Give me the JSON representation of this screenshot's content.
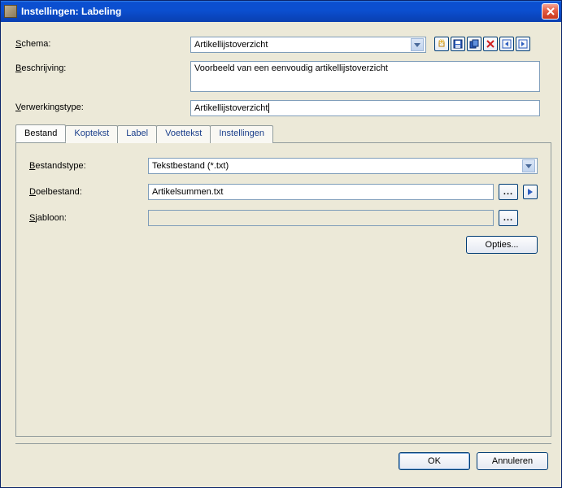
{
  "window": {
    "title": "Instellingen: Labeling"
  },
  "form": {
    "schema_label_pre": "S",
    "schema_label_post": "chema:",
    "beschrijving_label_pre": "B",
    "beschrijving_label_post": "eschrijving:",
    "verwerkingstype_label_pre": "V",
    "verwerkingstype_label_post": "erwerkingstype:",
    "schema_value": "Artikellijstoverzicht",
    "beschrijving_value": "Voorbeeld van een eenvoudig artikellijstoverzicht",
    "verwerkingstype_value": "Artikellijstoverzicht"
  },
  "toolbar_icons": [
    "new-icon",
    "save-icon",
    "copy-icon",
    "delete-icon",
    "prev-icon",
    "next-icon"
  ],
  "tabs": [
    {
      "label": "Bestand",
      "active": true
    },
    {
      "label": "Koptekst",
      "active": false
    },
    {
      "label": "Label",
      "active": false
    },
    {
      "label": "Voettekst",
      "active": false
    },
    {
      "label": "Instellingen",
      "active": false
    }
  ],
  "panel": {
    "bestandstype_label_pre": "B",
    "bestandstype_label_post": "estandstype:",
    "doelbestand_label_pre": "D",
    "doelbestand_label_post": "oelbestand:",
    "sjabloon_label_pre": "S",
    "sjabloon_label_post": "jabloon:",
    "bestandstype_value": "Tekstbestand (*.txt)",
    "doelbestand_value": "Artikelsummen.txt",
    "sjabloon_value": "",
    "browse_label": "...",
    "options_label": "Opties..."
  },
  "footer": {
    "ok": "OK",
    "cancel": "Annuleren"
  }
}
